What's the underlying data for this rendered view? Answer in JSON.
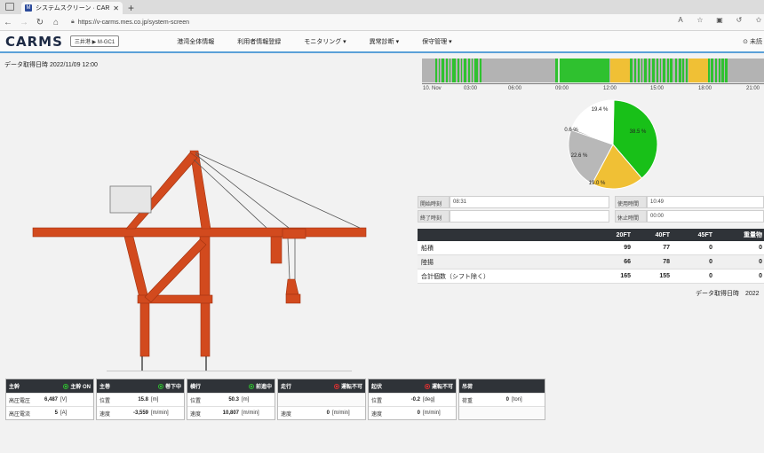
{
  "browser": {
    "tab_title": "システムスクリーン · CARMS",
    "tab_favicon": "M",
    "url": "https://v-carms.mes.co.jp/system-screen",
    "read_aloud": "Ả"
  },
  "header": {
    "logo": "CARMS",
    "logo_sub": "Crane Automated Remote Monitoring System",
    "site_selector": "三井港 ▶ M-GC1",
    "menu": [
      "港湾全体情報",
      "利用者情報登録",
      "モニタリング ▾",
      "異常診断 ▾",
      "保守管理 ▾"
    ],
    "right_text": "未読"
  },
  "data_time": "データ取得日時 2022/11/09 12:00",
  "timeline": {
    "colors": {
      "green": "#2fc12f",
      "gray": "#b3b3b3",
      "yellow": "#f0c035"
    },
    "axis_labels": [
      "10. Nov",
      "03:00",
      "06:00",
      "09:00",
      "12:00",
      "15:00",
      "18:00",
      "21:00"
    ]
  },
  "pie": {
    "slices": [
      {
        "label": "38.5 %",
        "value": 38.5,
        "color": "#18c018"
      },
      {
        "label": "19.0 %",
        "value": 19.0,
        "color": "#f0c035"
      },
      {
        "label": "22.6 %",
        "value": 22.6,
        "color": "#b8b8b8"
      },
      {
        "label": "0.6 %",
        "value": 0.6,
        "color": "#888888"
      },
      {
        "label": "19.4 %",
        "value": 19.4,
        "color": "#ffffff"
      }
    ]
  },
  "operation_info": {
    "start_label": "開始時刻",
    "start_value": "08:31",
    "end_label": "終了時刻",
    "end_value": "",
    "usage_label": "使用時間",
    "usage_value": "10:49",
    "rest_label": "休止時間",
    "rest_value": "00:00"
  },
  "counts": {
    "headers": [
      "",
      "20FT",
      "40FT",
      "45FT",
      "重量物"
    ],
    "rows": [
      {
        "label": "船積",
        "v20": "99",
        "v40": "77",
        "v45": "0",
        "heavy": "0"
      },
      {
        "label": "陸揚",
        "v20": "66",
        "v40": "78",
        "v45": "0",
        "heavy": "0"
      },
      {
        "label": "合計個数（シフト除く）",
        "v20": "165",
        "v40": "155",
        "v45": "0",
        "heavy": "0"
      }
    ],
    "footer": "データ取得日時　2022"
  },
  "panels": [
    {
      "title": "主幹",
      "status": "主幹 ON",
      "status_color": "#2fc12f",
      "rows": [
        {
          "k": "高圧電圧",
          "v": "6,487",
          "u": "[V]"
        },
        {
          "k": "高圧電流",
          "v": "5",
          "u": "[A]"
        }
      ]
    },
    {
      "title": "主巻",
      "status": "巻下中",
      "status_color": "#2fc12f",
      "rows": [
        {
          "k": "位置",
          "v": "15.8",
          "u": "[m]"
        },
        {
          "k": "速度",
          "v": "-3,559",
          "u": "[m/min]"
        }
      ]
    },
    {
      "title": "横行",
      "status": "前進中",
      "status_color": "#2fc12f",
      "rows": [
        {
          "k": "位置",
          "v": "50.3",
          "u": "[m]"
        },
        {
          "k": "速度",
          "v": "10,807",
          "u": "[m/min]"
        }
      ]
    },
    {
      "title": "走行",
      "status": "運転不可",
      "status_color": "#e03030",
      "rows": [
        {
          "k": "",
          "v": "",
          "u": ""
        },
        {
          "k": "速度",
          "v": "0",
          "u": "[m/min]"
        }
      ]
    },
    {
      "title": "起伏",
      "status": "運転不可",
      "status_color": "#e03030",
      "rows": [
        {
          "k": "位置",
          "v": "-0.2",
          "u": "[deg]"
        },
        {
          "k": "速度",
          "v": "0",
          "u": "[m/min]"
        }
      ]
    },
    {
      "title": "吊荷",
      "status": "",
      "status_color": "",
      "rows": [
        {
          "k": "荷重",
          "v": "0",
          "u": "[ton]"
        },
        {
          "k": "",
          "v": "",
          "u": ""
        }
      ]
    }
  ]
}
